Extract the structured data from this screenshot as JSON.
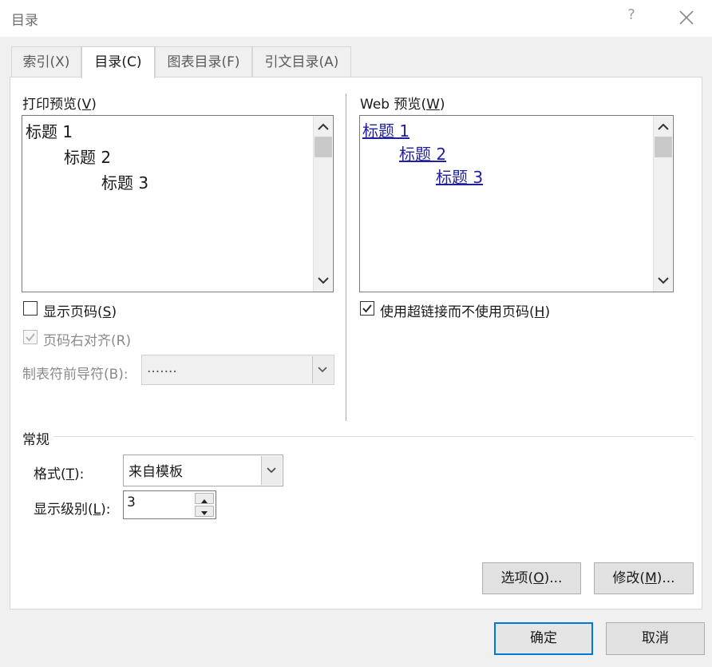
{
  "window": {
    "title": "目录",
    "help_label": "?"
  },
  "tabs": [
    {
      "label": "索引(X)"
    },
    {
      "label": "目录(C)",
      "active": true
    },
    {
      "label": "图表目录(F)"
    },
    {
      "label": "引文目录(A)"
    }
  ],
  "print_preview": {
    "label_main": "打印预览(",
    "label_key": "V",
    "label_end": ")",
    "lines": [
      {
        "text": "标题  1"
      },
      {
        "text": "标题  2"
      },
      {
        "text": "标题  3"
      }
    ]
  },
  "web_preview": {
    "label_main": "Web 预览(",
    "label_key": "W",
    "label_end": ")",
    "lines": [
      {
        "text": "标题  1"
      },
      {
        "text": "标题  2"
      },
      {
        "text": "标题  3"
      }
    ]
  },
  "options": {
    "show_page_numbers": {
      "label_main": "显示页码(",
      "label_key": "S",
      "label_end": ")",
      "checked": false
    },
    "right_align": {
      "label": "页码右对齐(R)",
      "checked": true,
      "disabled": true
    },
    "tab_leader": {
      "label": "制表符前导符(B):",
      "value": ".......",
      "disabled": true
    },
    "use_hyperlinks": {
      "label_main": "使用超链接而不使用页码(",
      "label_key": "H",
      "label_end": ")",
      "checked": true
    }
  },
  "general": {
    "heading": "常规",
    "format": {
      "label_main": "格式(",
      "label_key": "T",
      "label_end": "):",
      "value": "来自模板"
    },
    "levels": {
      "label_main": "显示级别(",
      "label_key": "L",
      "label_end": "):",
      "value": "3"
    }
  },
  "buttons": {
    "options": {
      "label_main": "选项(",
      "label_key": "O",
      "label_end": ")..."
    },
    "modify": {
      "label_main": "修改(",
      "label_key": "M",
      "label_end": ")..."
    },
    "ok": "确定",
    "cancel": "取消"
  },
  "colors": {
    "link": "#1f1fa0",
    "default_button_border": "#0078d7"
  },
  "icons": [
    "close-icon",
    "scroll-up-icon",
    "scroll-down-icon",
    "checkmark-icon",
    "chevron-down-icon",
    "spin-up-icon",
    "spin-down-icon"
  ]
}
